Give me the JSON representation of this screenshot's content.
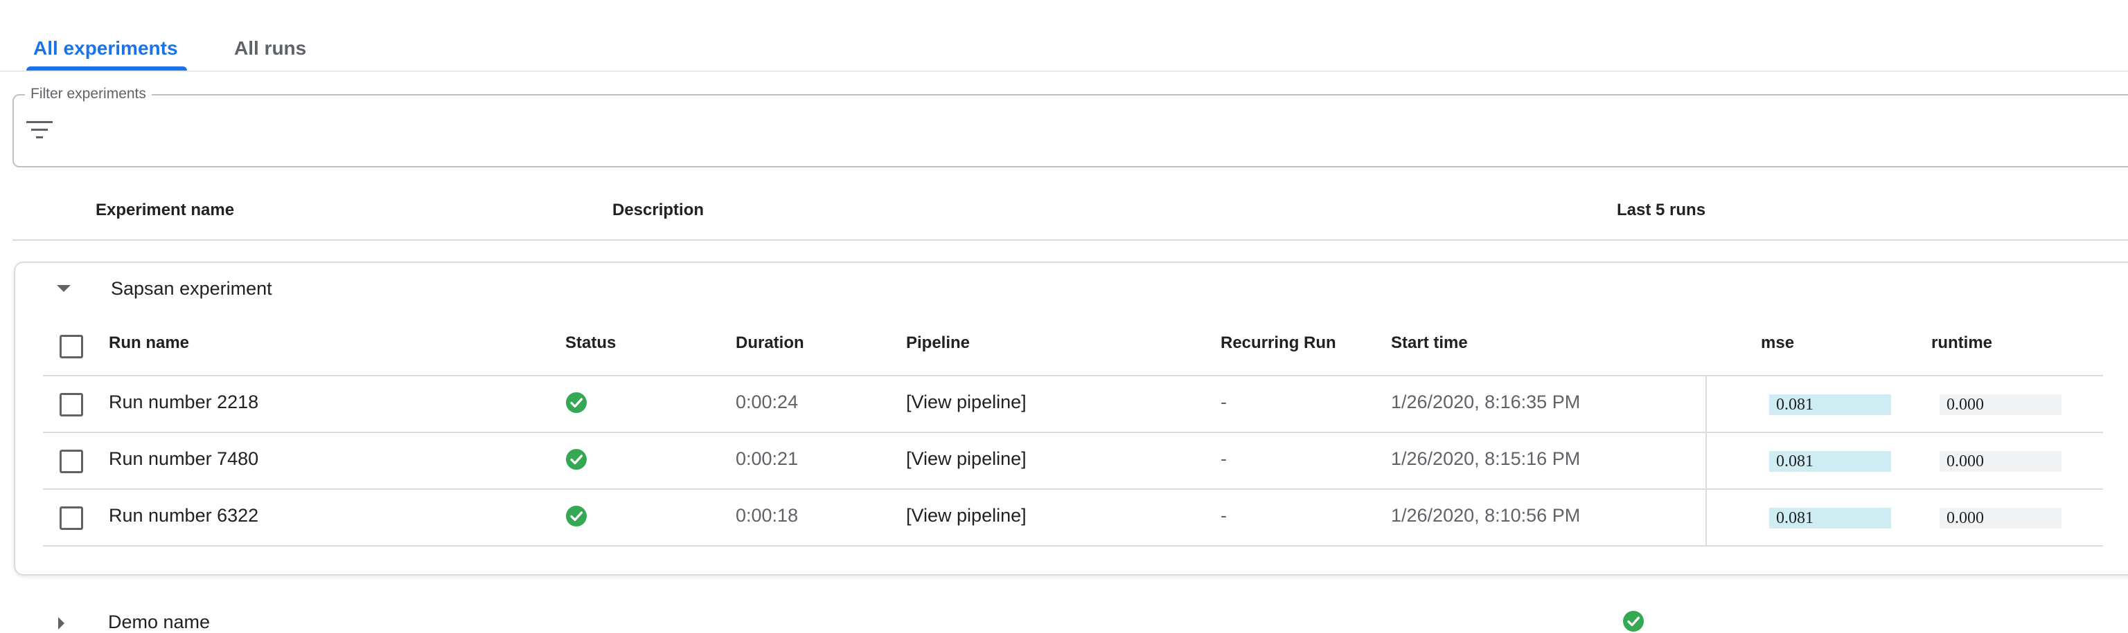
{
  "tabs": [
    {
      "label": "All experiments",
      "active": true
    },
    {
      "label": "All runs",
      "active": false
    }
  ],
  "filter": {
    "label": "Filter experiments",
    "value": "",
    "icon": "filter-list-icon"
  },
  "table": {
    "columns": [
      "Experiment name",
      "Description",
      "Last 5 runs"
    ]
  },
  "experiments": [
    {
      "name": "Sapsan experiment",
      "expanded": true,
      "runs_table": {
        "columns": [
          "Run name",
          "Status",
          "Duration",
          "Pipeline",
          "Recurring Run",
          "Start time",
          "mse",
          "runtime"
        ],
        "rows": [
          {
            "name": "Run number 2218",
            "status": "succeeded",
            "duration": "0:00:24",
            "pipeline": "[View pipeline]",
            "recurring": "-",
            "start_time": "1/26/2020, 8:16:35 PM",
            "mse": "0.081",
            "mse_fill": 1.0,
            "runtime": "0.000",
            "runtime_fill": 0.0
          },
          {
            "name": "Run number 7480",
            "status": "succeeded",
            "duration": "0:00:21",
            "pipeline": "[View pipeline]",
            "recurring": "-",
            "start_time": "1/26/2020, 8:15:16 PM",
            "mse": "0.081",
            "mse_fill": 1.0,
            "runtime": "0.000",
            "runtime_fill": 0.0
          },
          {
            "name": "Run number 6322",
            "status": "succeeded",
            "duration": "0:00:18",
            "pipeline": "[View pipeline]",
            "recurring": "-",
            "start_time": "1/26/2020, 8:10:56 PM",
            "mse": "0.081",
            "mse_fill": 1.0,
            "runtime": "0.000",
            "runtime_fill": 0.0
          }
        ]
      }
    },
    {
      "name": "Demo name",
      "expanded": false,
      "last_runs_status": [
        "succeeded"
      ]
    }
  ],
  "colors": {
    "accent": "#1a73e8",
    "success": "#34a853",
    "metric_fill": "#d1edf4",
    "metric_track": "#f1f3f4"
  }
}
